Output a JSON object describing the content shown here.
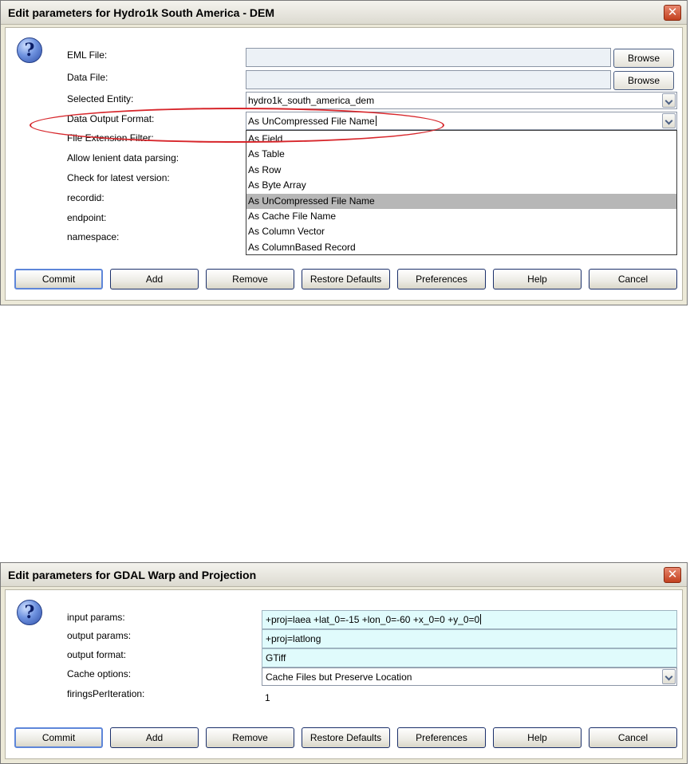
{
  "dialog1": {
    "title": "Edit parameters for Hydro1k South America - DEM",
    "close_glyph": "✕",
    "labels": {
      "eml_file": "EML File:",
      "data_file": "Data File:",
      "selected_entity": "Selected Entity:",
      "data_output_format": "Data Output Format:",
      "file_extension_filter": "File Extension Filter:",
      "allow_lenient": "Allow lenient data parsing:",
      "check_latest": "Check for latest version:",
      "recordid": "recordid:",
      "endpoint": "endpoint:",
      "namespace": "namespace:"
    },
    "eml_file_value": "",
    "data_file_value": "",
    "browse_label": "Browse",
    "selected_entity_value": "hydro1k_south_america_dem",
    "data_output_format_value": "As UnCompressed File Name",
    "format_options": [
      "As Field",
      "As Table",
      "As Row",
      "As Byte Array",
      "As UnCompressed File Name",
      "As Cache File Name",
      "As Column Vector",
      "As ColumnBased Record"
    ],
    "selected_option": "As UnCompressed File Name",
    "annotation_color": "#d7262b"
  },
  "dialog2": {
    "title": "Edit parameters for GDAL Warp and Projection",
    "close_glyph": "✕",
    "labels": {
      "input_params": "input params:",
      "output_params": "output params:",
      "output_format": "output format:",
      "cache_options": "Cache options:",
      "firings": "firingsPerIteration:"
    },
    "input_params_value": "+proj=laea +lat_0=-15 +lon_0=-60 +x_0=0 +y_0=0",
    "output_params_value": "+proj=latlong",
    "output_format_value": "GTiff",
    "cache_options_value": "Cache Files but Preserve Location",
    "firings_value": "1"
  },
  "buttons": {
    "commit": "Commit",
    "add": "Add",
    "remove": "Remove",
    "restore_defaults": "Restore Defaults",
    "preferences": "Preferences",
    "help": "Help",
    "cancel": "Cancel"
  },
  "icons": {
    "question": "question-icon",
    "question_glyph": "?"
  }
}
